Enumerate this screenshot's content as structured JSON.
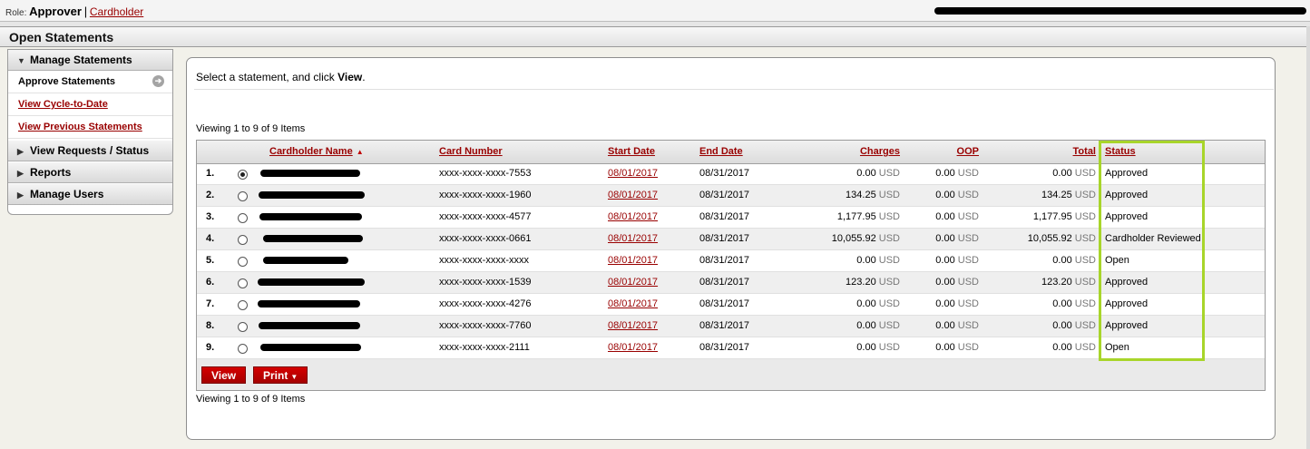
{
  "role_bar": {
    "role_label": "Role:",
    "active_role": "Approver",
    "separator": "|",
    "other_role": "Cardholder"
  },
  "page_title": "Open Statements",
  "sidebar": {
    "sections": [
      {
        "label": "Manage Statements",
        "expanded": true,
        "items": [
          {
            "label": "Approve Statements",
            "active": true,
            "icon": "arrow-right-circle-icon"
          },
          {
            "label": "View Cycle-to-Date",
            "active": false
          },
          {
            "label": "View Previous Statements",
            "active": false
          }
        ]
      },
      {
        "label": "View Requests / Status",
        "expanded": false
      },
      {
        "label": "Reports",
        "expanded": false
      },
      {
        "label": "Manage Users",
        "expanded": false
      }
    ]
  },
  "main": {
    "instruction_prefix": "Select a statement, and click ",
    "instruction_bold": "View",
    "instruction_suffix": ".",
    "viewing_text": "Viewing 1 to 9 of 9 Items",
    "columns": {
      "cardholder_name": "Cardholder Name",
      "card_number": "Card Number",
      "start_date": "Start Date",
      "end_date": "End Date",
      "charges": "Charges",
      "oop": "OOP",
      "total": "Total",
      "status": "Status"
    },
    "sort_column": "cardholder_name",
    "currency": "USD",
    "rows": [
      {
        "num": "1.",
        "selected": true,
        "card": "xxxx-xxxx-xxxx-7553",
        "start": "08/01/2017",
        "end": "08/31/2017",
        "charges": "0.00",
        "oop": "0.00",
        "total": "0.00",
        "status": "Approved"
      },
      {
        "num": "2.",
        "selected": false,
        "card": "xxxx-xxxx-xxxx-1960",
        "start": "08/01/2017",
        "end": "08/31/2017",
        "charges": "134.25",
        "oop": "0.00",
        "total": "134.25",
        "status": "Approved"
      },
      {
        "num": "3.",
        "selected": false,
        "card": "xxxx-xxxx-xxxx-4577",
        "start": "08/01/2017",
        "end": "08/31/2017",
        "charges": "1,177.95",
        "oop": "0.00",
        "total": "1,177.95",
        "status": "Approved"
      },
      {
        "num": "4.",
        "selected": false,
        "card": "xxxx-xxxx-xxxx-0661",
        "start": "08/01/2017",
        "end": "08/31/2017",
        "charges": "10,055.92",
        "oop": "0.00",
        "total": "10,055.92",
        "status": "Cardholder Reviewed"
      },
      {
        "num": "5.",
        "selected": false,
        "card": "xxxx-xxxx-xxxx-xxxx",
        "start": "08/01/2017",
        "end": "08/31/2017",
        "charges": "0.00",
        "oop": "0.00",
        "total": "0.00",
        "status": "Open"
      },
      {
        "num": "6.",
        "selected": false,
        "card": "xxxx-xxxx-xxxx-1539",
        "start": "08/01/2017",
        "end": "08/31/2017",
        "charges": "123.20",
        "oop": "0.00",
        "total": "123.20",
        "status": "Approved"
      },
      {
        "num": "7.",
        "selected": false,
        "card": "xxxx-xxxx-xxxx-4276",
        "start": "08/01/2017",
        "end": "08/31/2017",
        "charges": "0.00",
        "oop": "0.00",
        "total": "0.00",
        "status": "Approved"
      },
      {
        "num": "8.",
        "selected": false,
        "card": "xxxx-xxxx-xxxx-7760",
        "start": "08/01/2017",
        "end": "08/31/2017",
        "charges": "0.00",
        "oop": "0.00",
        "total": "0.00",
        "status": "Approved"
      },
      {
        "num": "9.",
        "selected": false,
        "card": "xxxx-xxxx-xxxx-2111",
        "start": "08/01/2017",
        "end": "08/31/2017",
        "charges": "0.00",
        "oop": "0.00",
        "total": "0.00",
        "status": "Open"
      }
    ],
    "buttons": {
      "view": "View",
      "print": "Print"
    }
  },
  "colors": {
    "link": "#990000",
    "button": "#c00000",
    "status_highlight": "#a8d52a"
  }
}
